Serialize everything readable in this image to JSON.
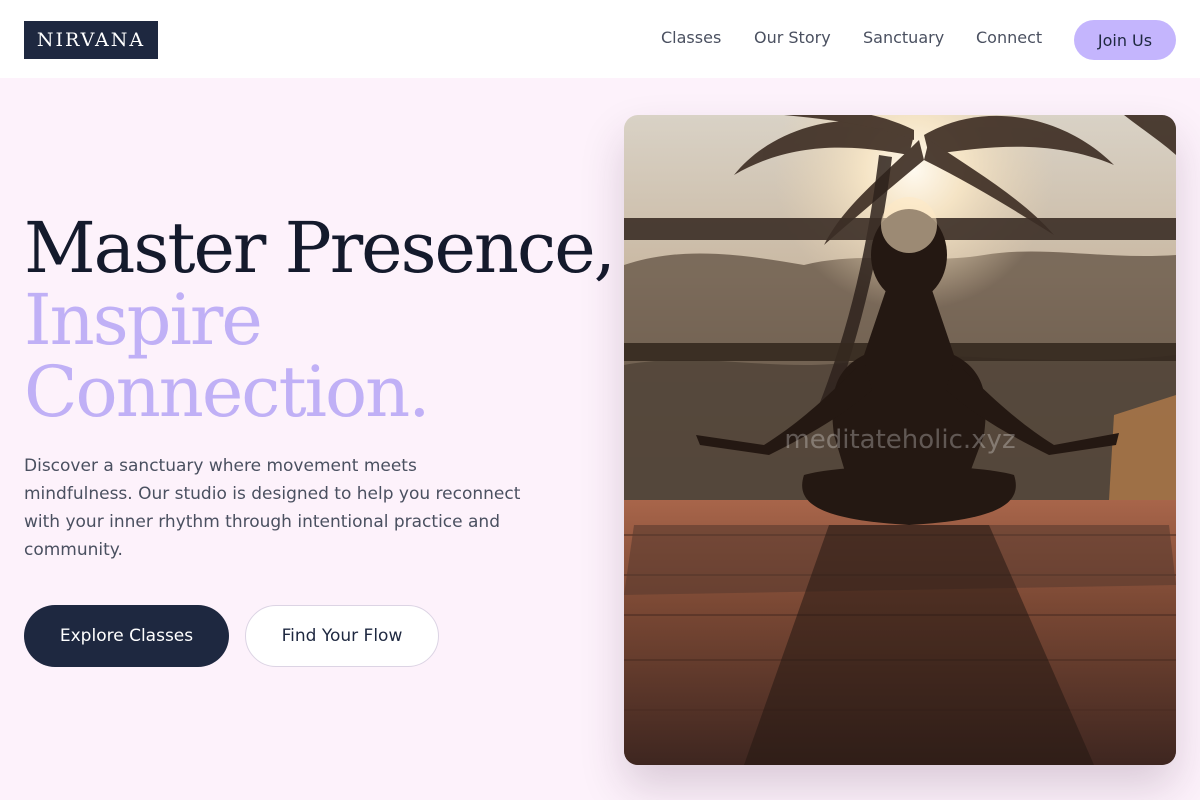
{
  "header": {
    "logo_text": "NIRVANA",
    "nav": [
      "Classes",
      "Our Story",
      "Sanctuary",
      "Connect"
    ],
    "cta_label": "Join Us"
  },
  "hero": {
    "title_line1": "Master Presence,",
    "title_line2": "Inspire",
    "title_line3": "Connection.",
    "description": "Discover a sanctuary where movement meets mindfulness. Our studio is designed to help you reconnect with your inner rhythm through intentional practice and community.",
    "primary_button": "Explore Classes",
    "secondary_button": "Find Your Flow",
    "image_watermark": "meditateholic.xyz"
  },
  "colors": {
    "brand_dark": "#1e2840",
    "accent_lavender": "#c4b5fd",
    "page_background": "#fdf2fb"
  }
}
